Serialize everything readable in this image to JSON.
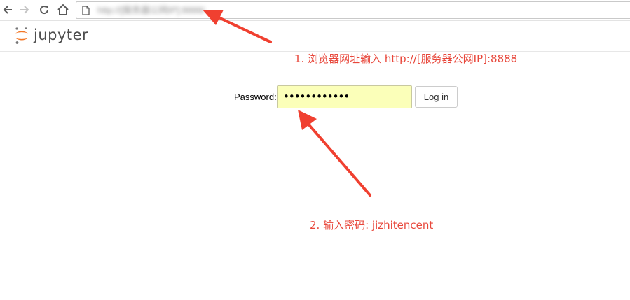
{
  "browser": {
    "back_icon": "arrow-left-icon",
    "forward_icon": "arrow-right-icon",
    "reload_icon": "reload-icon",
    "home_icon": "home-icon",
    "page_icon": "page-icon",
    "url": "http://[服务器公网IP]:8888/"
  },
  "header": {
    "logo_text": "jupyter",
    "logo_colors": {
      "orange": "#f37726",
      "gray": "#767677"
    }
  },
  "login": {
    "password_label": "Password:",
    "password_value": "••••••••••••",
    "login_button_label": "Log in",
    "input_background": "#fbffb9"
  },
  "annotations": {
    "note_1": "1. 浏览器网址输入 http://[服务器公网IP]:8888",
    "note_2": "2. 输入密码: jizhitencent",
    "color": "#e8473b"
  }
}
